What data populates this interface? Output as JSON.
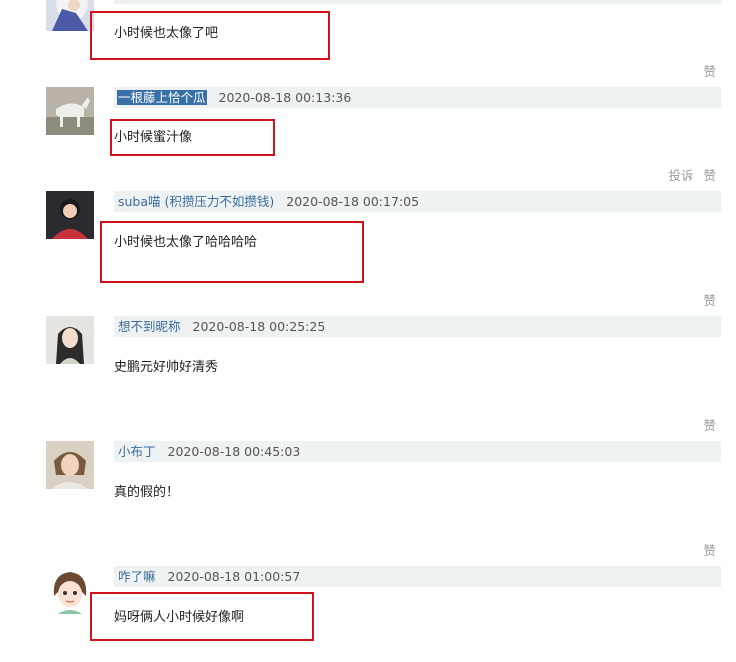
{
  "comments": [
    {
      "username": "",
      "timestamp": "",
      "text": "小时候也太像了吧",
      "like_label": "赞"
    },
    {
      "username": "一根藤上恰个瓜",
      "timestamp": "2020-08-18 00:13:36",
      "text": "小时候蜜汁像",
      "report_label": "投诉",
      "like_label": "赞"
    },
    {
      "username": "suba喵 (积攒压力不如攒钱)",
      "timestamp": "2020-08-18 00:17:05",
      "text": "小时候也太像了哈哈哈哈",
      "like_label": "赞"
    },
    {
      "username": "想不到昵称",
      "timestamp": "2020-08-18 00:25:25",
      "text": "史鹏元好帅好清秀",
      "like_label": "赞"
    },
    {
      "username": "小布丁",
      "timestamp": "2020-08-18 00:45:03",
      "text": "真的假的！",
      "like_label": "赞"
    },
    {
      "username": "咋了嘛",
      "timestamp": "2020-08-18 01:00:57",
      "text": "妈呀俩人小时候好像啊"
    }
  ],
  "colors": {
    "highlight_border": "#d0141b",
    "username": "#3b6c9a",
    "meta_bg": "#eef2f3"
  }
}
